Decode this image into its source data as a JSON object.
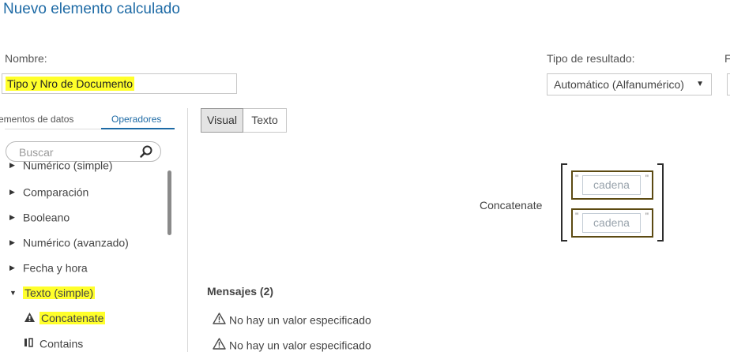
{
  "header": {
    "title": "Nuevo elemento calculado"
  },
  "form": {
    "name_label": "Nombre:",
    "name_value": "Tipo y Nro de Documento",
    "result_type_label": "Tipo de resultado:",
    "result_type_value": "Automático (Alfanumérico)",
    "cut_label": "F"
  },
  "left_panel": {
    "tabs": [
      {
        "label": "ementos de datos",
        "active": false
      },
      {
        "label": "Operadores",
        "active": true
      }
    ],
    "search_placeholder": "Buscar",
    "tree": [
      {
        "label": "Numérico (simple)",
        "expanded": false
      },
      {
        "label": "Comparación",
        "expanded": false
      },
      {
        "label": "Booleano",
        "expanded": false
      },
      {
        "label": "Numérico (avanzado)",
        "expanded": false
      },
      {
        "label": "Fecha y hora",
        "expanded": false
      },
      {
        "label": "Texto (simple)",
        "expanded": true,
        "highlighted": true
      }
    ],
    "children": [
      {
        "label": "Concatenate",
        "icon": "warning-triangle-icon",
        "highlighted": true
      },
      {
        "label": "Contains",
        "icon": "contains-icon"
      }
    ]
  },
  "editor": {
    "mode_buttons": [
      {
        "label": "Visual",
        "active": true
      },
      {
        "label": "Texto",
        "active": false
      }
    ],
    "expression": {
      "operator_label": "Concatenate",
      "quote_glyph": "\"",
      "slots": [
        {
          "placeholder": "cadena"
        },
        {
          "placeholder": "cadena"
        }
      ]
    }
  },
  "messages": {
    "title": "Mensajes (2)",
    "items": [
      {
        "text": "No hay un valor especificado",
        "icon": "warning-icon"
      },
      {
        "text": "No hay un valor especificado",
        "icon": "warning-icon"
      }
    ]
  },
  "colors": {
    "accent": "#1d6aa5",
    "highlight": "#ffff2a",
    "slot_border": "#5c4a12"
  }
}
